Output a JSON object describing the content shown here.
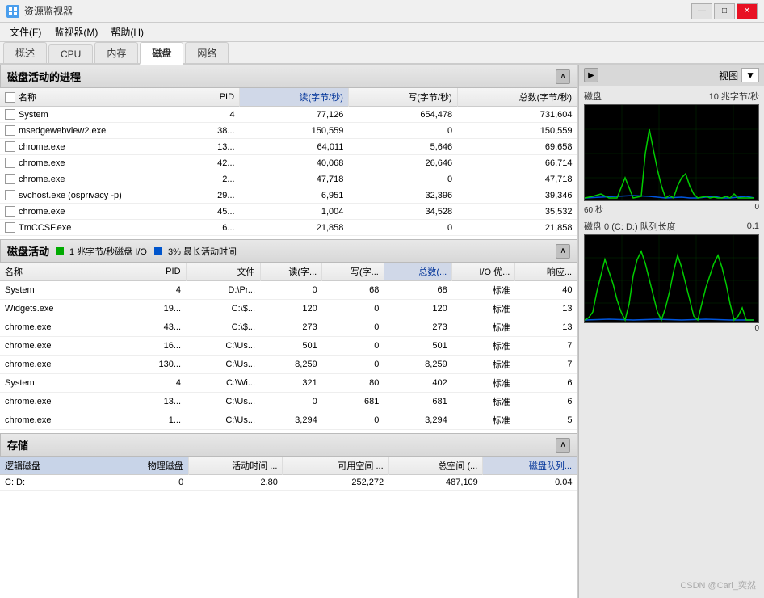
{
  "titleBar": {
    "icon": "★",
    "title": "资源监视器",
    "minimizeLabel": "—",
    "maximizeLabel": "□",
    "closeLabel": "✕"
  },
  "menuBar": {
    "items": [
      "文件(F)",
      "监视器(M)",
      "帮助(H)"
    ]
  },
  "tabs": {
    "items": [
      "概述",
      "CPU",
      "内存",
      "磁盘",
      "网络"
    ],
    "activeIndex": 3
  },
  "diskProcessSection": {
    "title": "磁盘活动的进程",
    "collapseLabel": "∧",
    "columns": [
      "名称",
      "PID",
      "读(字节/秒)",
      "写(字节/秒)",
      "总数(字节/秒)"
    ],
    "rows": [
      {
        "name": "System",
        "pid": "4",
        "read": "77,126",
        "write": "654,478",
        "total": "731,604"
      },
      {
        "name": "msedgewebview2.exe",
        "pid": "38...",
        "read": "150,559",
        "write": "0",
        "total": "150,559"
      },
      {
        "name": "chrome.exe",
        "pid": "13...",
        "read": "64,011",
        "write": "5,646",
        "total": "69,658"
      },
      {
        "name": "chrome.exe",
        "pid": "42...",
        "read": "40,068",
        "write": "26,646",
        "total": "66,714"
      },
      {
        "name": "chrome.exe",
        "pid": "2...",
        "read": "47,718",
        "write": "0",
        "total": "47,718"
      },
      {
        "name": "svchost.exe (osprivacy -p)",
        "pid": "29...",
        "read": "6,951",
        "write": "32,396",
        "total": "39,346"
      },
      {
        "name": "chrome.exe",
        "pid": "45...",
        "read": "1,004",
        "write": "34,528",
        "total": "35,532"
      },
      {
        "name": "TmCCSF.exe",
        "pid": "6...",
        "read": "21,858",
        "write": "0",
        "total": "21,858"
      }
    ]
  },
  "diskActivitySection": {
    "title": "磁盘活动",
    "badgeLabel1": "1 兆字节/秒磁盘 I/O",
    "badgeLabel2": "3% 最长活动时间",
    "collapseLabel": "∧",
    "columns": [
      "名称",
      "PID",
      "文件",
      "读(字...",
      "写(字...",
      "总数(...",
      "I/O 优...",
      "响应..."
    ],
    "rows": [
      {
        "name": "System",
        "pid": "4",
        "file": "D:\\Pr...",
        "read": "0",
        "write": "68",
        "total": "68",
        "io": "标准",
        "resp": "40"
      },
      {
        "name": "Widgets.exe",
        "pid": "19...",
        "file": "C:\\$...",
        "read": "120",
        "write": "0",
        "total": "120",
        "io": "标准",
        "resp": "13"
      },
      {
        "name": "chrome.exe",
        "pid": "43...",
        "file": "C:\\$...",
        "read": "273",
        "write": "0",
        "total": "273",
        "io": "标准",
        "resp": "13"
      },
      {
        "name": "chrome.exe",
        "pid": "16...",
        "file": "C:\\Us...",
        "read": "501",
        "write": "0",
        "total": "501",
        "io": "标准",
        "resp": "7"
      },
      {
        "name": "chrome.exe",
        "pid": "130...",
        "file": "C:\\Us...",
        "read": "8,259",
        "write": "0",
        "total": "8,259",
        "io": "标准",
        "resp": "7"
      },
      {
        "name": "System",
        "pid": "4",
        "file": "C:\\Wi...",
        "read": "321",
        "write": "80",
        "total": "402",
        "io": "标准",
        "resp": "6"
      },
      {
        "name": "chrome.exe",
        "pid": "13...",
        "file": "C:\\Us...",
        "read": "0",
        "write": "681",
        "total": "681",
        "io": "标准",
        "resp": "6"
      },
      {
        "name": "chrome.exe",
        "pid": "1...",
        "file": "C:\\Us...",
        "read": "3,294",
        "write": "0",
        "total": "3,294",
        "io": "标准",
        "resp": "5"
      }
    ]
  },
  "storageSection": {
    "title": "存储",
    "collapseLabel": "∧",
    "columns": [
      "逻辑磁盘",
      "物理磁盘",
      "活动时间 ...",
      "可用空间 ...",
      "总空间 (...",
      "磁盘队列..."
    ],
    "rows": [
      {
        "logical": "C: D:",
        "physical": "0",
        "active": "2.80",
        "free": "252,272",
        "total": "487,109",
        "queue": "0.04"
      }
    ]
  },
  "rightPanel": {
    "expandLabel": "▶",
    "viewLabel": "视图",
    "dropdownArrow": "▼",
    "chart1": {
      "label": "磁盘",
      "unit": "10 兆字节/秒",
      "seconds": "60 秒",
      "rightVal": "0"
    },
    "chart2": {
      "label": "磁盘 0 (C: D:) 队列长度",
      "unit": "0.1",
      "bottomLeft": "",
      "bottomRight": "0"
    }
  },
  "watermark": "CSDN @Carl_奕然"
}
